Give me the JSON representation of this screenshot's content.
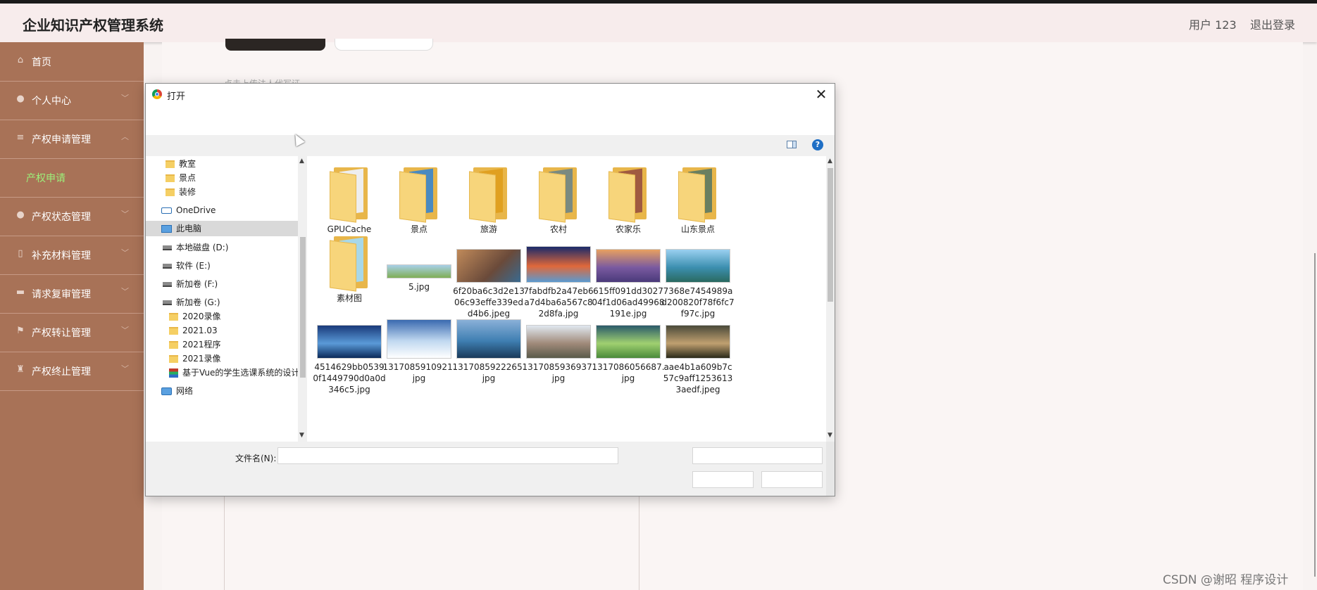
{
  "header": {
    "app_title": "企业知识产权管理系统",
    "user": "用户 123",
    "logout": "退出登录"
  },
  "sidebar": {
    "items": [
      {
        "label": "首页",
        "icon": "home-icon"
      },
      {
        "label": "个人中心",
        "icon": "user-icon"
      },
      {
        "label": "产权申请管理",
        "icon": "menu-icon"
      },
      {
        "label": "产权申请",
        "icon": ""
      },
      {
        "label": "产权状态管理",
        "icon": "user-icon"
      },
      {
        "label": "补充材料管理",
        "icon": "phone-icon"
      },
      {
        "label": "请求复审管理",
        "icon": "chat-icon"
      },
      {
        "label": "产权转让管理",
        "icon": "flag-icon"
      },
      {
        "label": "产权终止管理",
        "icon": "trophy-icon"
      }
    ]
  },
  "content": {
    "hint": "点击上传法人代写证"
  },
  "dialog": {
    "title": "打开",
    "close": "✕",
    "help": "?",
    "nav_tree": [
      {
        "label": "教室",
        "icon": "folder-icon"
      },
      {
        "label": "景点",
        "icon": "folder-icon"
      },
      {
        "label": "装修",
        "icon": "folder-icon"
      },
      {
        "label": "OneDrive",
        "icon": "onedrive-icon"
      },
      {
        "label": "此电脑",
        "icon": "this-pc-icon"
      },
      {
        "label": "本地磁盘 (D:)",
        "icon": "drive-icon"
      },
      {
        "label": "软件 (E:)",
        "icon": "drive-icon"
      },
      {
        "label": "新加卷 (F:)",
        "icon": "drive-icon"
      },
      {
        "label": "新加卷 (G:)",
        "icon": "drive-icon"
      },
      {
        "label": "2020录像",
        "icon": "folder-icon"
      },
      {
        "label": "2021.03",
        "icon": "folder-icon"
      },
      {
        "label": "2021程序",
        "icon": "folder-icon"
      },
      {
        "label": "2021录像",
        "icon": "folder-icon"
      },
      {
        "label": "基于Vue的学生选课系统的设计",
        "icon": "archive-icon"
      },
      {
        "label": "网络",
        "icon": "network-icon"
      }
    ],
    "files": [
      {
        "name": "GPUCache",
        "kind": "folder"
      },
      {
        "name": "景点",
        "kind": "folder"
      },
      {
        "name": "旅游",
        "kind": "folder"
      },
      {
        "name": "农村",
        "kind": "folder"
      },
      {
        "name": "农家乐",
        "kind": "folder"
      },
      {
        "name": "山东景点",
        "kind": "folder"
      },
      {
        "name": "素材图",
        "kind": "folder"
      },
      {
        "name": "5.jpg",
        "kind": "image",
        "color": "#7fae55"
      },
      {
        "name": "6f20ba6c3d2e1306c93effe339edd4b6.jpeg",
        "kind": "image",
        "color": "#a0643f"
      },
      {
        "name": "7fabdfb2a47eb6a7d4ba6a567c82d8fa.jpg",
        "kind": "image",
        "color": "#e0683a"
      },
      {
        "name": "615ff091dd302704f1d06ad49968191e.jpg",
        "kind": "image",
        "color": "#7a5aa0"
      },
      {
        "name": "7368e7454989ad200820f78f6fc7f97c.jpg",
        "kind": "image",
        "color": "#3c8fb0"
      },
      {
        "name": "4514629bb05390f1449790d0a0d346c5.jpg",
        "kind": "image",
        "color": "#2e5f9c"
      },
      {
        "name": "1317085910921.jpg",
        "kind": "image",
        "color": "#6aa0d8"
      },
      {
        "name": "1317085922265.jpg",
        "kind": "image",
        "color": "#3f7fb2"
      },
      {
        "name": "1317085936937.jpg",
        "kind": "image",
        "color": "#8a7a6a"
      },
      {
        "name": "1317086056687.jpg",
        "kind": "image",
        "color": "#7fb86a"
      },
      {
        "name": "aae4b1a609b7c57c9aff12536133aedf.jpeg",
        "kind": "image",
        "color": "#6a5a40"
      }
    ],
    "filename_label": "文件名(N):",
    "filename_value": ""
  },
  "watermark": "CSDN @谢昭 程序设计",
  "colors": {
    "sidebar": "#a87257",
    "sidebar_active_text": "#9cf07a",
    "header_bg": "#f7ecec"
  }
}
